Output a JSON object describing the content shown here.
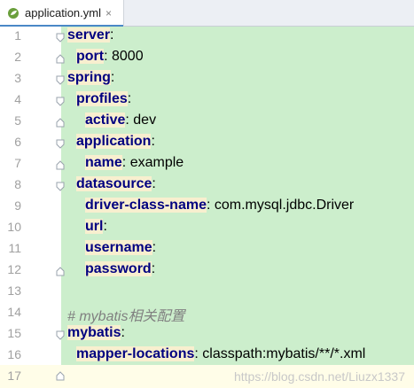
{
  "tab": {
    "file_name": "application.yml",
    "close_glyph": "×",
    "icon": "yaml-leaf-icon",
    "accent_color": "#4a88c7"
  },
  "editor": {
    "highlight_color": "#cceecc",
    "key_color": "#000080",
    "key_background": "#f8efcf",
    "lines": [
      {
        "number": "1",
        "key": "server",
        "colon": ":",
        "value": ""
      },
      {
        "number": "2",
        "key": "port",
        "colon": ":",
        "value": " 8000"
      },
      {
        "number": "3",
        "key": "spring",
        "colon": ":",
        "value": ""
      },
      {
        "number": "4",
        "key": "profiles",
        "colon": ":",
        "value": ""
      },
      {
        "number": "5",
        "key": "active",
        "colon": ":",
        "value": " dev"
      },
      {
        "number": "6",
        "key": "application",
        "colon": ":",
        "value": ""
      },
      {
        "number": "7",
        "key": "name",
        "colon": ":",
        "value": " example"
      },
      {
        "number": "8",
        "key": "datasource",
        "colon": ":",
        "value": ""
      },
      {
        "number": "9",
        "key": "driver-class-name",
        "colon": ":",
        "value": " com.mysql.jdbc.Driver"
      },
      {
        "number": "10",
        "key": "url",
        "colon": ":",
        "value": ""
      },
      {
        "number": "11",
        "key": "username",
        "colon": ":",
        "value": ""
      },
      {
        "number": "12",
        "key": "password",
        "colon": ":",
        "value": ""
      },
      {
        "number": "13",
        "key": "",
        "colon": "",
        "value": ""
      },
      {
        "number": "14",
        "comment": "# mybatis相关配置"
      },
      {
        "number": "15",
        "key": "mybatis",
        "colon": ":",
        "value": ""
      },
      {
        "number": "16",
        "key": "mapper-locations",
        "colon": ":",
        "value": " classpath:mybatis/**/*.xml"
      },
      {
        "number": "17",
        "key": "",
        "colon": "",
        "value": ""
      }
    ]
  },
  "watermark": "https://blog.csdn.net/Liuzx1337"
}
